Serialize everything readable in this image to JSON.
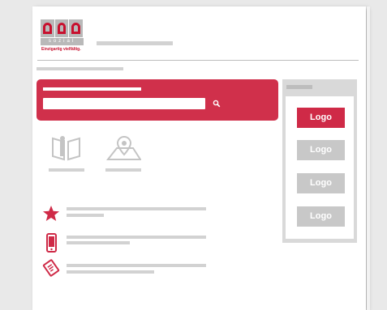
{
  "brand": {
    "wordmark": "con",
    "sub": "sozial",
    "claim": "Einzigartig vielfältig."
  },
  "search": {
    "placeholder": "",
    "button_icon": "search-icon"
  },
  "sidebar": {
    "logos": [
      "Logo",
      "Logo",
      "Logo",
      "Logo"
    ]
  },
  "colors": {
    "accent": "#d0304b",
    "inactive": "#c8c8c8",
    "placeholder_bar": "#d2d2d2"
  }
}
